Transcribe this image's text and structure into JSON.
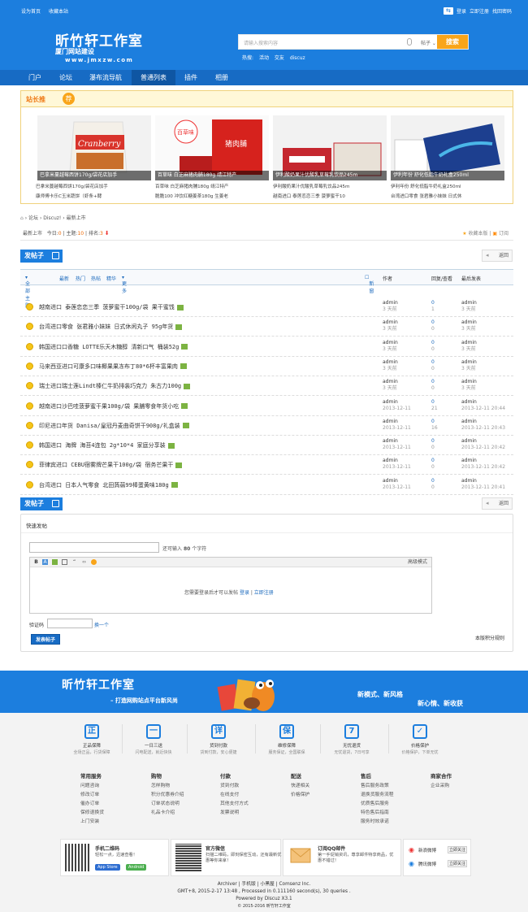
{
  "topbar": {
    "links": [
      "设为首页",
      "收藏本站"
    ],
    "login": "登录",
    "register": "立即注册",
    "forgot": "找回密码"
  },
  "brand": {
    "title": "昕竹轩工作室",
    "subtitle": "厦门网站建设",
    "url": "www.jmxzw.com"
  },
  "search": {
    "placeholder": "请输入搜索内容",
    "type": "帖子",
    "button": "搜索",
    "hot_label": "热搜:",
    "hot": [
      "活动",
      "交友",
      "discuz"
    ]
  },
  "nav": [
    "门户",
    "论坛",
    "瀑布流导航",
    "普通列表",
    "插件",
    "相册"
  ],
  "recommend": {
    "title": "站长推",
    "badge": "荐",
    "pics": [
      "巴拿米蔓越莓西饼170g/袋花店加手",
      "百草味 白芝麻猪肉脯180g 靖江特产",
      "伊利酸奶果汁优酸乳草莓乳饮品245m",
      "伊利年份 舒化低脂牛奶礼盒250ml"
    ],
    "links": [
      [
        "巴拿米蔓越莓西饼170g/袋花店加手",
        "康师傅卡乐C玉米蔬饼（虾条+酵"
      ],
      [
        "百草味 白芝麻猪肉脯180g 靖江特产",
        "脆脆100 冲饮红糖姜茶180g 生姜老"
      ],
      [
        "伊利酸奶果汁优酸乳草莓乳饮品245m",
        "越南进口 泰莲恋恋三季 菠萝蜜干10"
      ],
      [
        "伊利年份 舒化低脂牛奶礼盒250ml",
        "台湾进口零食 张君雅小妹妹 日式休"
      ]
    ]
  },
  "crumb": [
    "论坛",
    "Discuz!",
    "最新上市"
  ],
  "forum": {
    "name": "最新上市",
    "today_label": "今日:",
    "today": "0",
    "topics_label": "主题:",
    "topics": "10",
    "rank_label": "排名:",
    "rank": "3",
    "fav": "收藏本版",
    "rss": "订阅"
  },
  "post_button": "发帖子",
  "back": "返回",
  "thead": {
    "all": "全部主题",
    "tabs": [
      "最新",
      "热门",
      "热帖",
      "精华",
      "更多"
    ],
    "new": "新窗",
    "author": "作者",
    "reply": "回复/查看",
    "last": "最后发表"
  },
  "threads": [
    {
      "title": "越南进口 泰莲恋恋三季 菠萝蜜干100g/袋 果干蜜饯",
      "author": "admin",
      "adate": "3 天前",
      "reply": "0",
      "view": "1",
      "last": "admin",
      "ldate": "3 天前"
    },
    {
      "title": "台湾进口零食 张君雅小妹妹 日式休闲丸子 95g年货",
      "author": "admin",
      "adate": "3 天前",
      "reply": "0",
      "view": "0",
      "last": "admin",
      "ldate": "3 天前"
    },
    {
      "title": "韩国进口口香糖 LOTTE乐天木糖醇 清新口气 桶装52g",
      "author": "admin",
      "adate": "3 天前",
      "reply": "0",
      "view": "0",
      "last": "admin",
      "ldate": "3 天前"
    },
    {
      "title": "马来西亚进口可康多口味椰果果冻布丁80*6杯丰富果肉",
      "author": "admin",
      "adate": "3 天前",
      "reply": "0",
      "view": "0",
      "last": "admin",
      "ldate": "3 天前"
    },
    {
      "title": "瑞士进口瑞士莲Lindt榛仁牛奶排装巧克力 朱古力100g",
      "author": "admin",
      "adate": "3 天前",
      "reply": "0",
      "view": "0",
      "last": "admin",
      "ldate": "3 天前"
    },
    {
      "title": "越南进口沙巴哇菠萝蜜干果100g/袋 果脯零食年货小吃",
      "author": "admin",
      "adate": "2013-12-11",
      "reply": "0",
      "view": "21",
      "last": "admin",
      "ldate": "2013-12-11 20:44"
    },
    {
      "title": "印尼进口年货 Danisa/皇冠丹麦曲奇饼干908g/礼盒装",
      "author": "admin",
      "adate": "2013-12-11",
      "reply": "0",
      "view": "16",
      "last": "admin",
      "ldate": "2013-12-11 20:43"
    },
    {
      "title": "韩国进口 海牌 海苔4连包 2g*10*4 家庭分享装",
      "author": "admin",
      "adate": "2013-12-11",
      "reply": "0",
      "view": "0",
      "last": "admin",
      "ldate": "2013-12-11 20:42"
    },
    {
      "title": "菲律宾进口 CEBU宿雾牌芒果干100g/袋 宿务芒果干",
      "author": "admin",
      "adate": "2013-12-11",
      "reply": "0",
      "view": "0",
      "last": "admin",
      "ldate": "2013-12-11 20:42"
    },
    {
      "title": "台湾进口 日本人气零食 北田蒟蒻99棒蛋黄味180g",
      "author": "admin",
      "adate": "2013-12-11",
      "reply": "0",
      "view": "0",
      "last": "admin",
      "ldate": "2013-12-11 20:41"
    }
  ],
  "quick": {
    "title": "快速发帖",
    "hint_pre": "还可输入",
    "hint_num": "80",
    "hint_post": "个字符",
    "advanced": "高级模式",
    "msg": "您需要登录后才可以发帖",
    "login": "登录",
    "register": "立即注册",
    "vcode_label": "验证码",
    "vcode_link": "换一个",
    "submit": "发表帖子",
    "rule": "本版积分规则"
  },
  "banner": {
    "title": "昕竹轩工作室",
    "slogan": "– 打造网购站点平台新风尚",
    "right1": "新模式、新风格",
    "right2": "新心情、新收获"
  },
  "features": [
    {
      "ic": "正",
      "t": "正品保障",
      "s": "全场正品，行货保障"
    },
    {
      "ic": "一",
      "t": "一日三送",
      "s": "闪电配送，就近快快"
    },
    {
      "ic": "详",
      "t": "货到付款",
      "s": "货到付款，安心便捷"
    },
    {
      "ic": "保",
      "t": "维修保障",
      "s": "服务保证，全国联保"
    },
    {
      "ic": "7",
      "t": "无忧退货",
      "s": "无忧退货，7日可享"
    },
    {
      "ic": "✓",
      "t": "价格保护",
      "s": "价格保护，下单无忧"
    }
  ],
  "footcols": [
    {
      "h": "常用服务",
      "items": [
        "问题咨询",
        "修改订单",
        "催办订单",
        "保修退换货",
        "上门安装"
      ]
    },
    {
      "h": "购物",
      "items": [
        "怎样购物",
        "积分优惠券介绍",
        "订单状态说明",
        "礼品卡介绍"
      ]
    },
    {
      "h": "付款",
      "items": [
        "货到付款",
        "在线支付",
        "其他支付方式",
        "发票说明"
      ]
    },
    {
      "h": "配送",
      "items": [
        "快递相关",
        "价格保护"
      ]
    },
    {
      "h": "售后",
      "items": [
        "售后服务政策",
        "退换货服务流程",
        "优质售后服务",
        "特色售后指南",
        "服务时效承诺"
      ]
    },
    {
      "h": "商家合作",
      "items": [
        "企业采购"
      ]
    }
  ],
  "qrbox": [
    {
      "t": "手机二维码",
      "s": "轻松一点，迅速查看！",
      "b1": "App Store",
      "b2": "Android"
    },
    {
      "t": "官方微信",
      "s": "扫描二维码，即刻保密互动，还有最新优惠等你来拿！"
    },
    {
      "t": "订阅QQ邮件",
      "s": "第一手促销资讯，尊享邮件特享商品，优惠不错过！"
    },
    {
      "w1": "新浪微博",
      "w2": "腾讯微博",
      "f": "立即关注"
    }
  ],
  "copy": {
    "l1": "Archiver | 手机版 | 小黑屋 | Comsenz Inc.",
    "l2": "GMT+8, 2015-2-17 13:48 , Processed in 0.111160 second(s), 30 queries .",
    "l3": "Powered by Discuz X3.1",
    "l4": "© 2015-2016 昕竹轩工作室"
  },
  "colors": {
    "primary": "#1c7ede",
    "nav": "#176bc4",
    "accent": "#f9a51a"
  }
}
